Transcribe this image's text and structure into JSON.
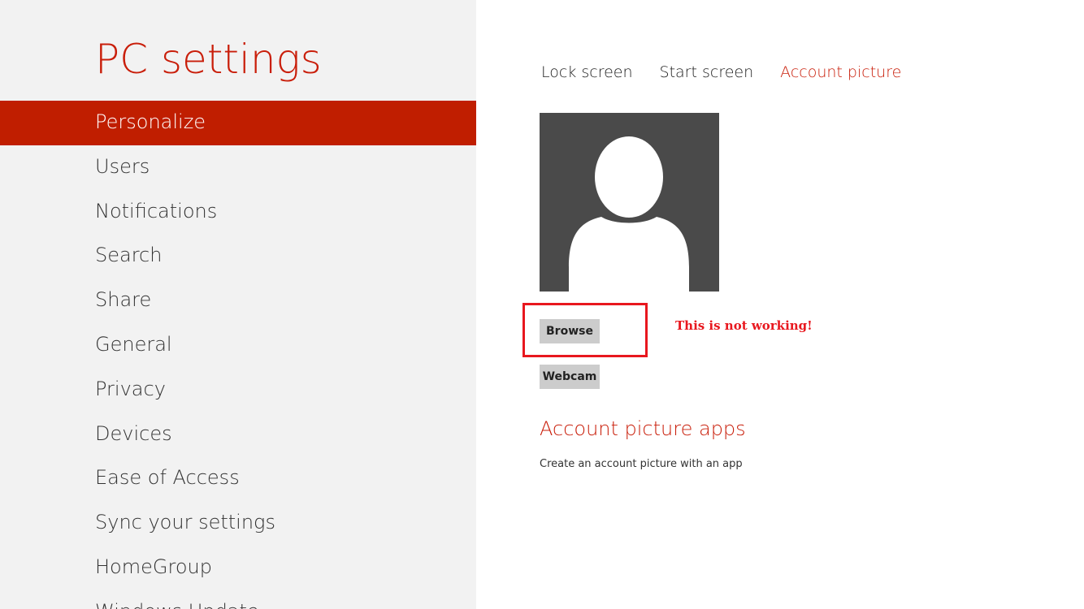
{
  "app": {
    "title": "PC settings"
  },
  "nav": {
    "items": [
      {
        "label": "Personalize",
        "selected": true
      },
      {
        "label": "Users"
      },
      {
        "label": "Notifications"
      },
      {
        "label": "Search"
      },
      {
        "label": "Share"
      },
      {
        "label": "General"
      },
      {
        "label": "Privacy"
      },
      {
        "label": "Devices"
      },
      {
        "label": "Ease of Access"
      },
      {
        "label": "Sync your settings"
      },
      {
        "label": "HomeGroup"
      },
      {
        "label": "Windows Update"
      }
    ]
  },
  "tabs": [
    {
      "label": "Lock screen"
    },
    {
      "label": "Start screen"
    },
    {
      "label": "Account picture",
      "active": true
    }
  ],
  "account_picture": {
    "browse_label": "Browse",
    "webcam_label": "Webcam",
    "annotation": "This is not working!"
  },
  "apps": {
    "heading": "Account picture apps",
    "description": "Create an account picture with an app"
  },
  "colors": {
    "accent": "#c01e00",
    "pane_bg": "#f2f2f2",
    "avatar_bg": "#4a4a4a",
    "annotation_red": "#e8171e"
  }
}
